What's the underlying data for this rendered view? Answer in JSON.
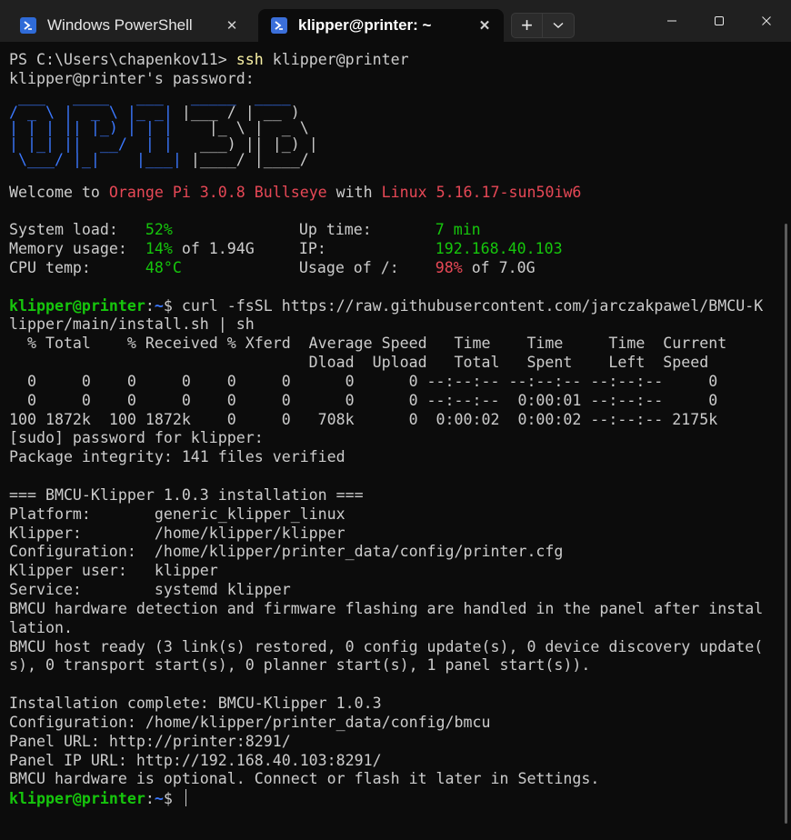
{
  "tabs": [
    {
      "title": "Windows PowerShell",
      "close": "✕"
    },
    {
      "title": "klipper@printer: ~",
      "close": "✕"
    }
  ],
  "toolbar": {
    "new_tab": "+",
    "dropdown": "⌄"
  },
  "window": {
    "minimize": "—",
    "maximize": "☐",
    "close": "✕"
  },
  "terminal": {
    "ps_prompt": "PS C:\\Users\\chapenkov11> ",
    "ssh_cmd": "ssh",
    "ssh_target": " klipper@printer",
    "password_prompt": "klipper@printer's password:",
    "banner": " ___   ____   ___   _____  ____  \n / _ \\ |  _ \\ |_ _| |___ / | __ ) \n| | | || |_) | | |    |_ \\ |  _ \\ \n| |_| ||  __/  | |   ___) || |_) |\n \\___/ |_|    |___| |____/ |____/ ",
    "welcome_prefix": "Welcome to ",
    "os_name": "Orange Pi 3.0.8 Bullseye",
    "welcome_with": " with ",
    "kernel": "Linux 5.16.17-sun50iw6",
    "sys_load_label": "System load:   ",
    "sys_load": "52%",
    "uptime_label": "Up time:       ",
    "uptime": "7 min",
    "mem_label": "Memory usage:  ",
    "mem_pct": "14%",
    "mem_of": " of 1.94G",
    "ip_label": "IP:            ",
    "ip": "192.168.40.103",
    "cpu_label": "CPU temp:      ",
    "cpu_temp": "48°C",
    "usage_label": "Usage of /:    ",
    "usage_pct": "98%",
    "usage_of": " of 7.0G",
    "prompt_user": "klipper@printer",
    "prompt_path": "~",
    "prompt_sym": "$ ",
    "curl_cmd_1": "curl -fsSL https://raw.githubusercontent.com/jarczakpawel/BMCU-K",
    "curl_cmd_2": "lipper/main/install.sh | sh",
    "curl_header_1": "  % Total    % Received % Xferd  Average Speed   Time    Time     Time  Current",
    "curl_header_2": "                                 Dload  Upload   Total   Spent    Left  Speed",
    "curl_row_1": "  0     0    0     0    0     0      0      0 --:--:-- --:--:-- --:--:--     0",
    "curl_row_2": "  0     0    0     0    0     0      0      0 --:--:--  0:00:01 --:--:--     0",
    "curl_row_3": "100 1872k  100 1872k    0     0   708k      0  0:00:02  0:00:02 --:--:-- 2175k",
    "sudo_prompt": "[sudo] password for klipper:",
    "integrity": "Package integrity: 141 files verified",
    "install_header": "=== BMCU-Klipper 1.0.3 installation ===",
    "platform": "Platform:       generic_klipper_linux",
    "klipper_path": "Klipper:        /home/klipper/klipper",
    "config_path": "Configuration:  /home/klipper/printer_data/config/printer.cfg",
    "klipper_user": "Klipper user:   klipper",
    "service": "Service:        systemd klipper",
    "hw_note_1": "BMCU hardware detection and firmware flashing are handled in the panel after instal",
    "hw_note_2": "lation.",
    "host_ready_1": "BMCU host ready (3 link(s) restored, 0 config update(s), 0 device discovery update(",
    "host_ready_2": "s), 0 transport start(s), 0 planner start(s), 1 panel start(s)).",
    "complete": "Installation complete: BMCU-Klipper 1.0.3",
    "config_dir": "Configuration: /home/klipper/printer_data/config/bmcu",
    "panel_url": "Panel URL: http://printer:8291/",
    "panel_ip_url": "Panel IP URL: http://192.168.40.103:8291/",
    "optional_note": "BMCU hardware is optional. Connect or flash it later in Settings."
  },
  "colors": {
    "accent_green": "#16c60c",
    "accent_blue": "#3b78ff",
    "accent_red": "#e74856",
    "background": "#0c0c0c"
  }
}
